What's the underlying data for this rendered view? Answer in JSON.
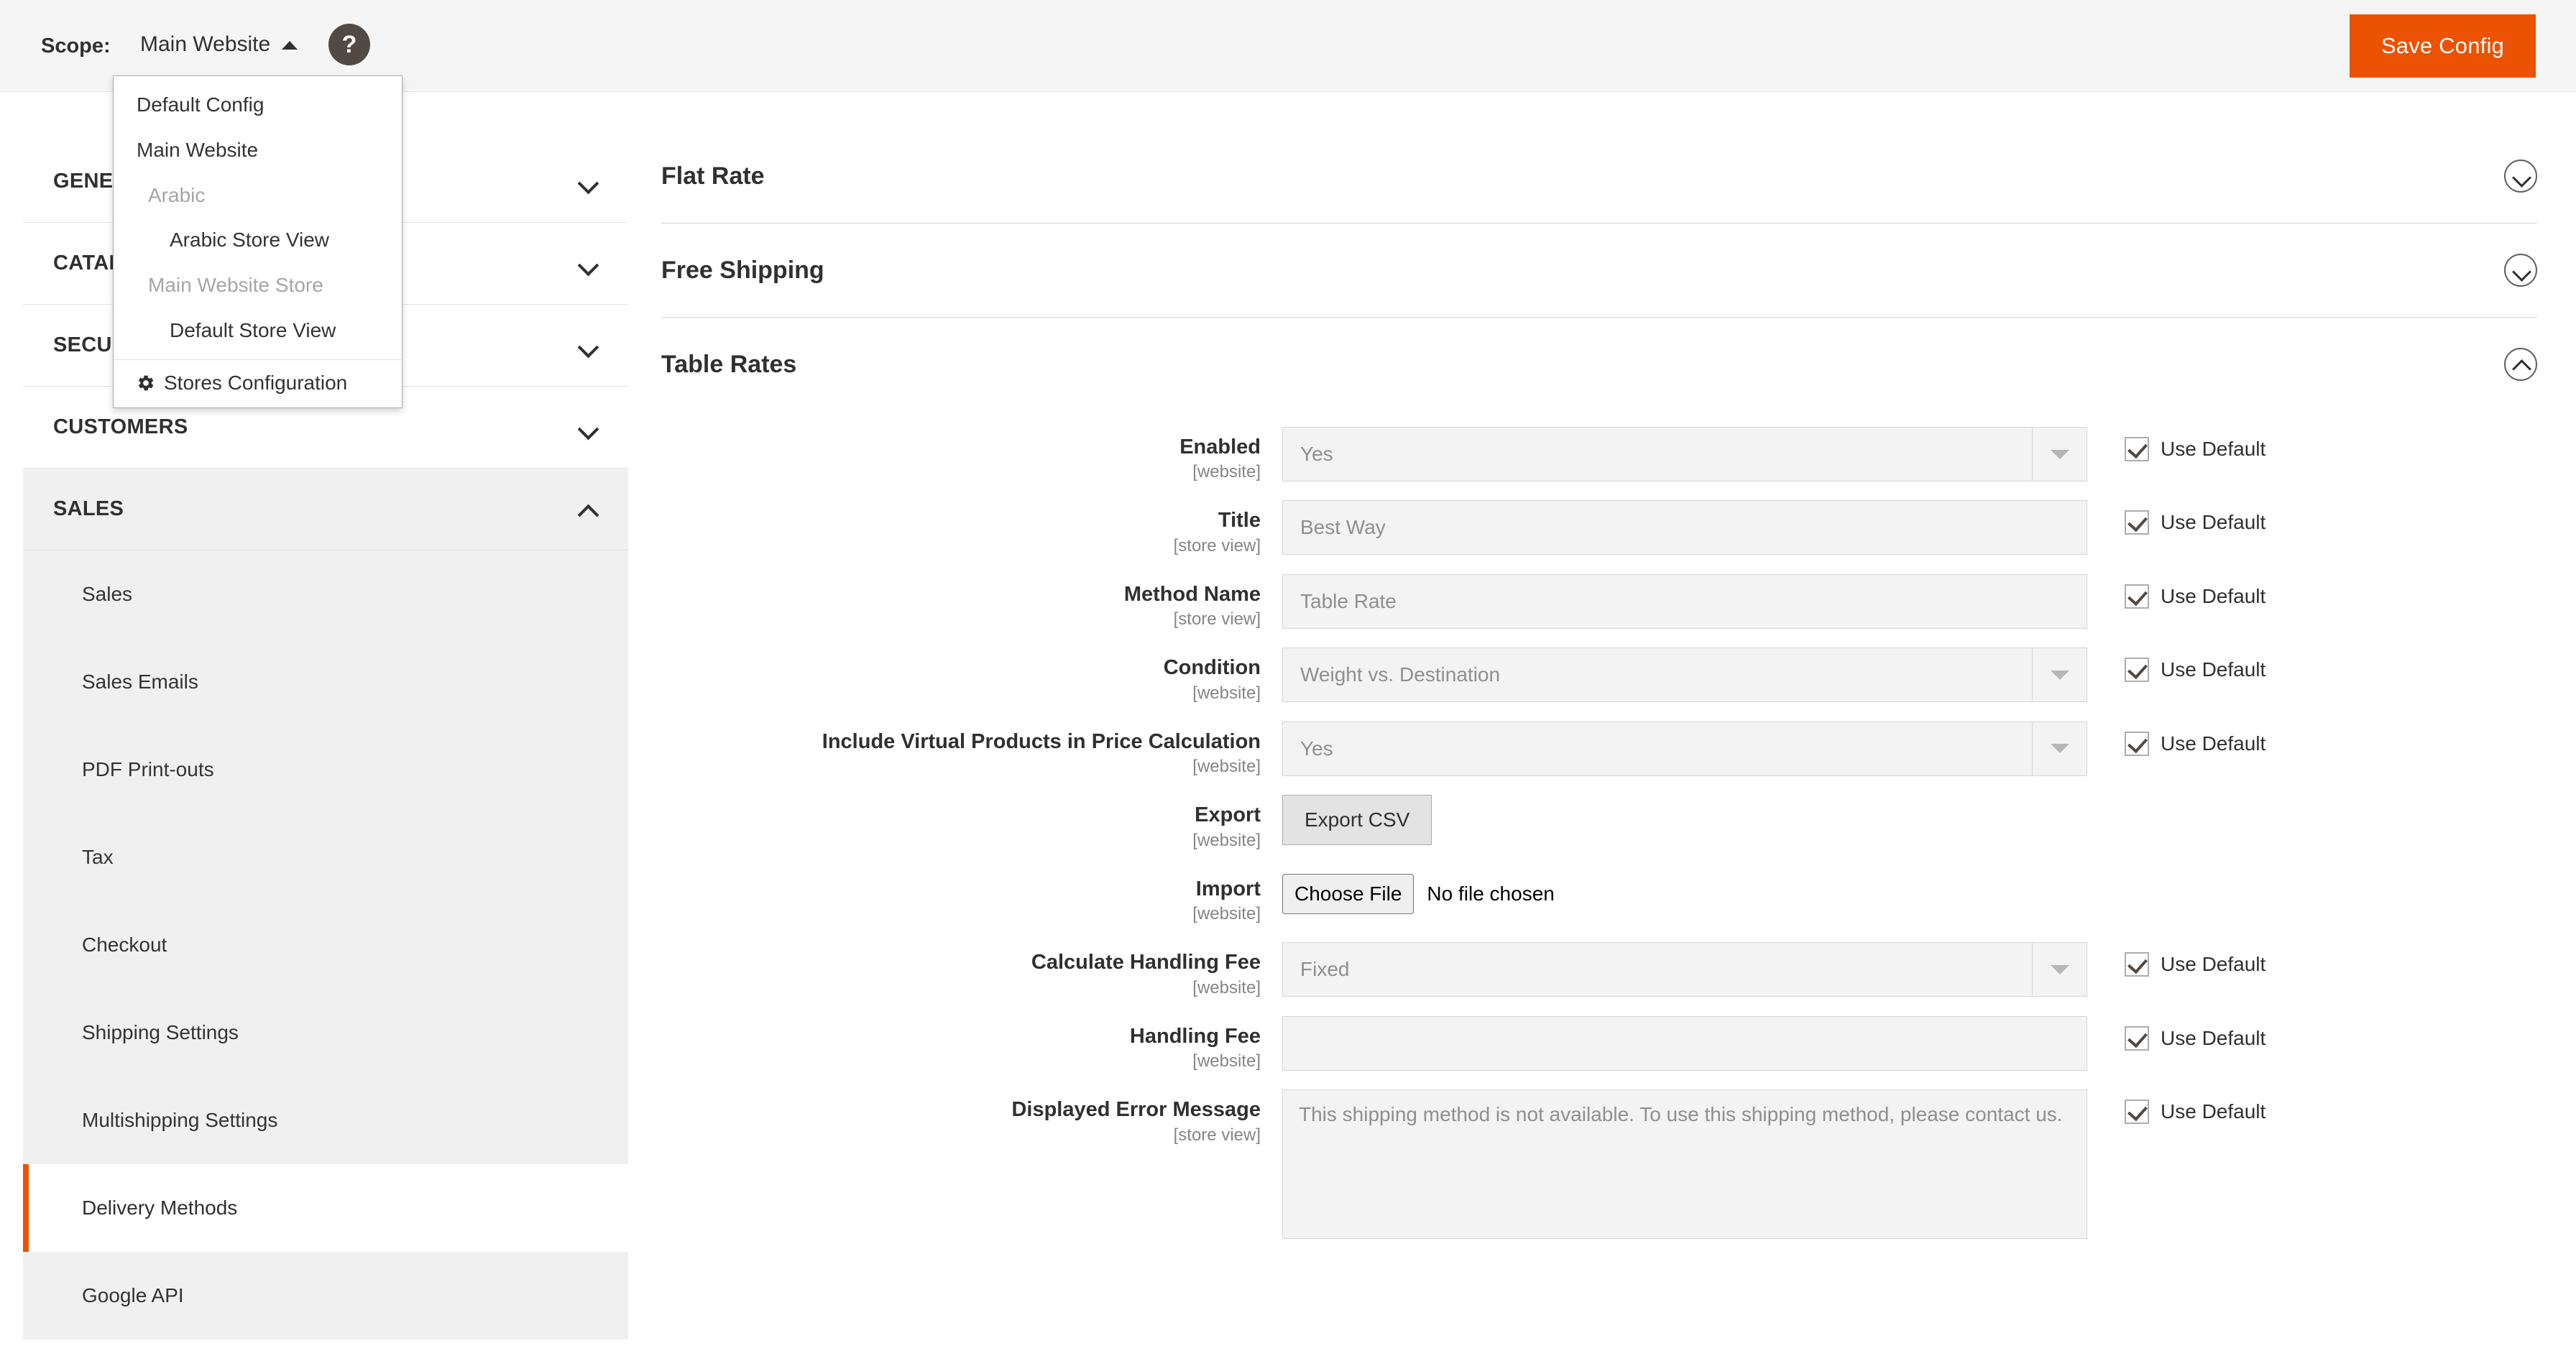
{
  "scope_bar": {
    "label": "Scope:",
    "current": "Main Website",
    "help_icon": "question-mark-icon",
    "save_button": "Save Config",
    "accent_color": "#eb5202"
  },
  "scope_dropdown": {
    "items": [
      {
        "label": "Default Config",
        "level": "root"
      },
      {
        "label": "Main Website",
        "level": "root"
      },
      {
        "label": "Arabic",
        "level": "group"
      },
      {
        "label": "Arabic Store View",
        "level": "store"
      },
      {
        "label": "Main Website Store",
        "level": "group"
      },
      {
        "label": "Default Store View",
        "level": "store"
      }
    ],
    "footer": {
      "label": "Stores Configuration",
      "icon": "gear-icon"
    }
  },
  "sidebar": {
    "sections": [
      {
        "title": "GENERAL",
        "open": false,
        "chevron": "chevron-down-icon"
      },
      {
        "title": "CATALOG",
        "open": false,
        "chevron": "chevron-down-icon"
      },
      {
        "title": "SECURITY",
        "open": false,
        "chevron": "chevron-down-icon"
      },
      {
        "title": "CUSTOMERS",
        "open": false,
        "chevron": "chevron-down-icon"
      },
      {
        "title": "SALES",
        "open": true,
        "chevron": "chevron-up-icon"
      }
    ],
    "sales_items": [
      {
        "label": "Sales",
        "active": false
      },
      {
        "label": "Sales Emails",
        "active": false
      },
      {
        "label": "PDF Print-outs",
        "active": false
      },
      {
        "label": "Tax",
        "active": false
      },
      {
        "label": "Checkout",
        "active": false
      },
      {
        "label": "Shipping Settings",
        "active": false
      },
      {
        "label": "Multishipping Settings",
        "active": false
      },
      {
        "label": "Delivery Methods",
        "active": true
      },
      {
        "label": "Google API",
        "active": false
      }
    ]
  },
  "main": {
    "sections": [
      {
        "title": "Flat Rate",
        "expanded": false
      },
      {
        "title": "Free Shipping",
        "expanded": false
      },
      {
        "title": "Table Rates",
        "expanded": true
      }
    ],
    "table_rates_fields": [
      {
        "label": "Enabled",
        "scope": "[website]",
        "control": "select",
        "value": "Yes",
        "use_default": true,
        "use_default_label": "Use Default"
      },
      {
        "label": "Title",
        "scope": "[store view]",
        "control": "input",
        "value": "Best Way",
        "use_default": true,
        "use_default_label": "Use Default"
      },
      {
        "label": "Method Name",
        "scope": "[store view]",
        "control": "input",
        "value": "Table Rate",
        "use_default": true,
        "use_default_label": "Use Default"
      },
      {
        "label": "Condition",
        "scope": "[website]",
        "control": "select",
        "value": "Weight vs. Destination",
        "use_default": true,
        "use_default_label": "Use Default"
      },
      {
        "label": "Include Virtual Products in Price Calculation",
        "scope": "[website]",
        "control": "select",
        "value": "Yes",
        "use_default": true,
        "use_default_label": "Use Default"
      },
      {
        "label": "Export",
        "scope": "[website]",
        "control": "button",
        "value": "Export CSV",
        "use_default": false,
        "use_default_label": ""
      },
      {
        "label": "Import",
        "scope": "[website]",
        "control": "file",
        "value": "Choose File",
        "file_status": "No file chosen",
        "use_default": false,
        "use_default_label": ""
      },
      {
        "label": "Calculate Handling Fee",
        "scope": "[website]",
        "control": "select",
        "value": "Fixed",
        "use_default": true,
        "use_default_label": "Use Default"
      },
      {
        "label": "Handling Fee",
        "scope": "[website]",
        "control": "input",
        "value": "",
        "use_default": true,
        "use_default_label": "Use Default"
      },
      {
        "label": "Displayed Error Message",
        "scope": "[store view]",
        "control": "textarea",
        "value": "This shipping method is not available. To use this shipping method, please contact us.",
        "use_default": true,
        "use_default_label": "Use Default"
      }
    ]
  }
}
